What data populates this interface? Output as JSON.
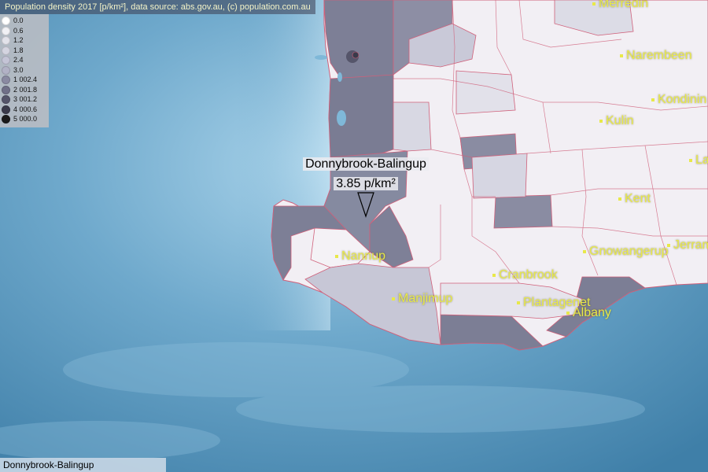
{
  "header": {
    "text": "Population density 2017 [p/km²], data source: abs.gov.au, (c) population.com.au"
  },
  "legend": [
    {
      "value": "0.0",
      "color": "#ffffff"
    },
    {
      "value": "0.6",
      "color": "#f1f1f5"
    },
    {
      "value": "1.2",
      "color": "#e2e2ea"
    },
    {
      "value": "1.8",
      "color": "#d4d4e0"
    },
    {
      "value": "2.4",
      "color": "#c4c4d6"
    },
    {
      "value": "3.0",
      "color": "#b2b2c6"
    },
    {
      "value": "1 002.4",
      "color": "#8a8aa2"
    },
    {
      "value": "2 001.8",
      "color": "#707088"
    },
    {
      "value": "3 001.2",
      "color": "#55556a"
    },
    {
      "value": "4 000.6",
      "color": "#3a3a4a"
    },
    {
      "value": "5 000.0",
      "color": "#1a1a1a"
    }
  ],
  "selected_region": {
    "name": "Donnybrook-Balingup",
    "density": "3.85 p/km²"
  },
  "towns": [
    {
      "name": "Merredin"
    },
    {
      "name": "Narembeen"
    },
    {
      "name": "Kondinin"
    },
    {
      "name": "Kulin"
    },
    {
      "name": "La"
    },
    {
      "name": "Kent"
    },
    {
      "name": "Jerram"
    },
    {
      "name": "Gnowangerup"
    },
    {
      "name": "Nannup"
    },
    {
      "name": "Cranbrook"
    },
    {
      "name": "Manjimup"
    },
    {
      "name": "Plantagenet"
    },
    {
      "name": "Albany"
    }
  ],
  "footer": {
    "text": "Donnybrook-Balingup"
  },
  "colors": {
    "ocean": "#6fa9cc",
    "land_light": "#f2eff4",
    "border": "#d0607a",
    "town_label": "#e8e84a"
  }
}
